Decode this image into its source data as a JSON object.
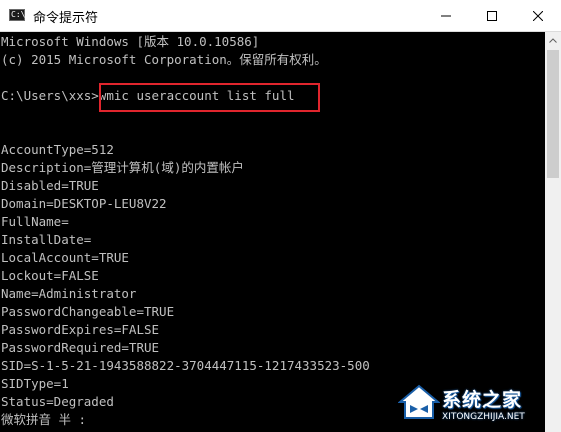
{
  "window": {
    "title": "命令提示符",
    "icon_label": "C:\\"
  },
  "console": {
    "lines": [
      "Microsoft Windows [版本 10.0.10586]",
      "(c) 2015 Microsoft Corporation。保留所有权利。",
      "",
      "C:\\Users\\xxs>wmic useraccount list full",
      "",
      "",
      "AccountType=512",
      "Description=管理计算机(域)的内置帐户",
      "Disabled=TRUE",
      "Domain=DESKTOP-LEU8V22",
      "FullName=",
      "InstallDate=",
      "LocalAccount=TRUE",
      "Lockout=FALSE",
      "Name=Administrator",
      "PasswordChangeable=TRUE",
      "PasswordExpires=FALSE",
      "PasswordRequired=TRUE",
      "SID=S-1-5-21-1943588822-3704447115-1217433523-500",
      "SIDType=1",
      "Status=Degraded",
      "微软拼音 半 :"
    ]
  },
  "watermark": {
    "title": "系统之家",
    "url": "XITONGZHIJIA.NET"
  },
  "colors": {
    "console_bg": "#000000",
    "console_text": "#c0c0c0",
    "highlight": "#e0252d",
    "titlebar_bg": "#ffffff"
  },
  "icons": {
    "window_icon": "cmd-icon",
    "minimize": "minimize-icon",
    "maximize": "maximize-icon",
    "close": "close-icon"
  }
}
